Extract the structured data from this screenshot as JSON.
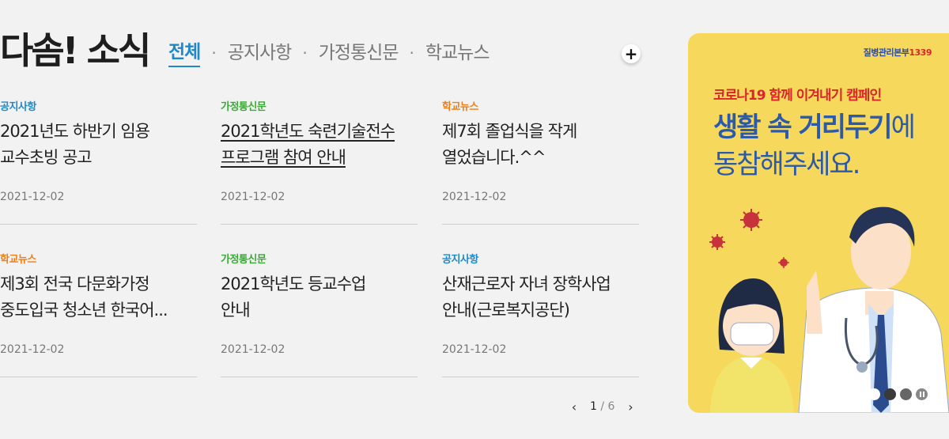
{
  "section": {
    "title": "다솜! 소식",
    "more_label": "+"
  },
  "tabs": [
    {
      "label": "전체",
      "active": true
    },
    {
      "label": "공지사항",
      "active": false
    },
    {
      "label": "가정통신문",
      "active": false
    },
    {
      "label": "학교뉴스",
      "active": false
    }
  ],
  "tab_separator": "·",
  "news": [
    {
      "category": "공지사항",
      "category_color": "#1e88c8",
      "title": "2021년도 하반기 임용\n교수초빙 공고",
      "date": "2021-12-02"
    },
    {
      "category": "가정통신문",
      "category_color": "#3aa935",
      "title": "2021학년도 숙련기술전수\n프로그램 참여 안내",
      "date": "2021-12-02"
    },
    {
      "category": "학교뉴스",
      "category_color": "#f07e19",
      "title": "제7회 졸업식을 작게\n열었습니다.^^",
      "date": "2021-12-02"
    },
    {
      "category": "학교뉴스",
      "category_color": "#f07e19",
      "title": "제3회 전국 다문화가정\n중도입국 청소년 한국어...",
      "date": "2021-12-02"
    },
    {
      "category": "가정통신문",
      "category_color": "#3aa935",
      "title": "2021학년도 등교수업\n안내",
      "date": "2021-12-02"
    },
    {
      "category": "공지사항",
      "category_color": "#1e88c8",
      "title": "산재근로자 자녀 장학사업\n안내(근로복지공단)",
      "date": "2021-12-02"
    }
  ],
  "pager": {
    "prev": "‹",
    "next": "›",
    "current": "1",
    "divider": "/",
    "total": "6"
  },
  "banner": {
    "org": "질병관리본부",
    "org_number": "1339",
    "campaign": "코로나19 함께 이겨내기 캠페인",
    "headline_bold": "생활 속 거리두기",
    "headline_rest": "에",
    "headline_line2": "동참해주세요."
  },
  "colors": {
    "accent": "#1e88c8",
    "banner_bg": "#f6d85c",
    "notice": "#1e88c8",
    "letter": "#3aa935",
    "school_news": "#f07e19"
  }
}
